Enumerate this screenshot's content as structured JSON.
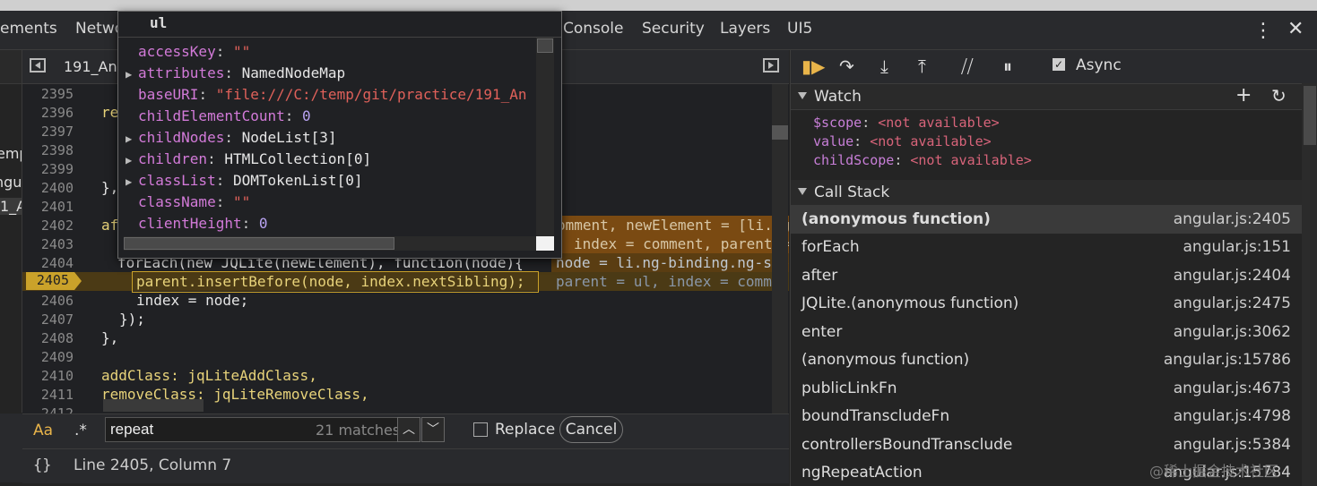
{
  "tabs": [
    "ements",
    "Netwo",
    "Console",
    "Security",
    "Layers",
    "UI5"
  ],
  "left_fragments": [
    "emp",
    "ngul",
    "1_A"
  ],
  "editor": {
    "file_tab": "191_An",
    "lines": [
      {
        "n": "2395",
        "code": ""
      },
      {
        "n": "2396",
        "code": "re"
      },
      {
        "n": "2397",
        "code": ""
      },
      {
        "n": "2398",
        "code": ""
      },
      {
        "n": "2399",
        "code": ""
      },
      {
        "n": "2400",
        "code": "},"
      },
      {
        "n": "2401",
        "code": ""
      },
      {
        "n": "2402",
        "code": "af"
      },
      {
        "n": "2403",
        "code": ""
      },
      {
        "n": "2404",
        "code": "forEach(new JQLite(newElement), function(node){"
      },
      {
        "n": "2405",
        "code": "parent.insertBefore(node, index.nextSibling);"
      },
      {
        "n": "2406",
        "code": "index = node;"
      },
      {
        "n": "2407",
        "code": "});"
      },
      {
        "n": "2408",
        "code": "},"
      },
      {
        "n": "2409",
        "code": ""
      },
      {
        "n": "2410",
        "code": "addClass: jqLiteAddClass,"
      },
      {
        "n": "2411",
        "code": "removeClass: jqLiteRemoveClass,"
      },
      {
        "n": "2412",
        "code": ""
      }
    ],
    "inline_values": {
      "l2402": "omment, newElement = [li.ng",
      "l2403": "index = comment, parent =",
      "l2404": "node = li.ng-binding.ng-sco",
      "l2405": "parent = ul, index = commen"
    }
  },
  "search": {
    "case_label": "Aa",
    "regex_label": ".*",
    "query": "repeat",
    "matches": "21 matches",
    "replace_label": "Replace",
    "cancel_label": "Cancel"
  },
  "status": {
    "braces": "{}",
    "position": "Line 2405, Column 7"
  },
  "debugger": {
    "async_label": "Async",
    "watch_title": "Watch",
    "watch": [
      {
        "name": "$scope",
        "value": "<not available>"
      },
      {
        "name": "value",
        "value": "<not available>"
      },
      {
        "name": "childScope",
        "value": "<not available>"
      }
    ],
    "callstack_title": "Call Stack",
    "callstack": [
      {
        "fn": "(anonymous function)",
        "loc": "angular.js:2405",
        "current": true
      },
      {
        "fn": "forEach",
        "loc": "angular.js:151"
      },
      {
        "fn": "after",
        "loc": "angular.js:2404"
      },
      {
        "fn": "JQLite.(anonymous function)",
        "loc": "angular.js:2475"
      },
      {
        "fn": "enter",
        "loc": "angular.js:3062"
      },
      {
        "fn": "(anonymous function)",
        "loc": "angular.js:15786"
      },
      {
        "fn": "publicLinkFn",
        "loc": "angular.js:4673"
      },
      {
        "fn": "boundTranscludeFn",
        "loc": "angular.js:4798"
      },
      {
        "fn": "controllersBoundTransclude",
        "loc": "angular.js:5384"
      },
      {
        "fn": "ngRepeatAction",
        "loc": "angular.js:15784"
      }
    ]
  },
  "popover": {
    "title": "ul",
    "props": [
      {
        "key": "accessKey",
        "value": "\"\"",
        "type": "str",
        "expandable": false
      },
      {
        "key": "attributes",
        "value": "NamedNodeMap",
        "type": "obj",
        "expandable": true
      },
      {
        "key": "baseURI",
        "value": "\"file:///C:/temp/git/practice/191_An",
        "type": "str",
        "expandable": false
      },
      {
        "key": "childElementCount",
        "value": "0",
        "type": "num",
        "expandable": false
      },
      {
        "key": "childNodes",
        "value": "NodeList[3]",
        "type": "obj",
        "expandable": true
      },
      {
        "key": "children",
        "value": "HTMLCollection[0]",
        "type": "obj",
        "expandable": true
      },
      {
        "key": "classList",
        "value": "DOMTokenList[0]",
        "type": "obj",
        "expandable": true
      },
      {
        "key": "className",
        "value": "\"\"",
        "type": "str",
        "expandable": false
      },
      {
        "key": "clientHeight",
        "value": "0",
        "type": "num",
        "expandable": false
      }
    ]
  },
  "watermark": "@稀土掘金技术社区"
}
